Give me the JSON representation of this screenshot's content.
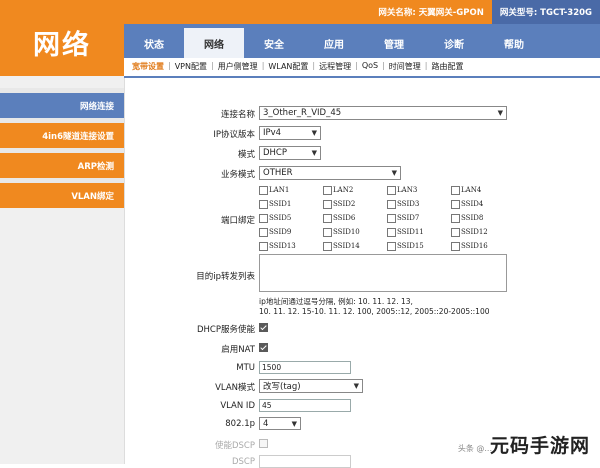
{
  "brand": {
    "title": "网络"
  },
  "gateway": {
    "name_label": "网关名称: 天翼网关-GPON",
    "model_label": "网关型号: TGCT-320G"
  },
  "colors": {
    "orange": "#f0891f",
    "blue": "#5b7fbc"
  },
  "main_tabs": [
    "状态",
    "网络",
    "安全",
    "应用",
    "管理",
    "诊断",
    "帮助"
  ],
  "active_tab": "网络",
  "sub_tabs": [
    "宽带设置",
    "VPN配置",
    "用户侧管理",
    "WLAN配置",
    "远程管理",
    "QoS",
    "时间管理",
    "路由配置"
  ],
  "sidebar": [
    "网络连接",
    "4in6隧道连接设置",
    "ARP检测",
    "VLAN绑定"
  ],
  "form": {
    "conn_name_label": "连接名称",
    "conn_name_value": "3_Other_R_VID_45",
    "ip_version_label": "IP协议版本",
    "ip_version_value": "IPv4",
    "mode_label": "模式",
    "mode_value": "DHCP",
    "service_mode_label": "业务模式",
    "service_mode_value": "OTHER",
    "port_bind_label": "端口绑定",
    "ports": [
      "LAN1",
      "LAN2",
      "LAN3",
      "LAN4",
      "SSID1",
      "SSID2",
      "SSID3",
      "SSID4",
      "SSID5",
      "SSID6",
      "SSID7",
      "SSID8",
      "SSID9",
      "SSID10",
      "SSID11",
      "SSID12",
      "SSID13",
      "SSID14",
      "SSID15",
      "SSID16"
    ],
    "dest_ip_label": "目的ip转发列表",
    "hint_line1": "ip地址间通过逗号分隔, 例如: 10. 11. 12. 13,",
    "hint_line2": "10. 11. 12. 15-10. 11. 12. 100, 2005::12, 2005::20-2005::100",
    "dhcp_label": "DHCP服务使能",
    "nat_label": "启用NAT",
    "mtu_label": "MTU",
    "mtu_value": "1500",
    "vlan_mode_label": "VLAN模式",
    "vlan_mode_value": "改写(tag)",
    "vlan_id_label": "VLAN ID",
    "vlan_id_value": "45",
    "p8021_label": "802.1p",
    "p8021_value": "4",
    "multicast_dscp_label": "使能DSCP",
    "dscp_label": "DSCP"
  },
  "watermark": {
    "small": "头条 @...",
    "big": "元码手游网"
  }
}
